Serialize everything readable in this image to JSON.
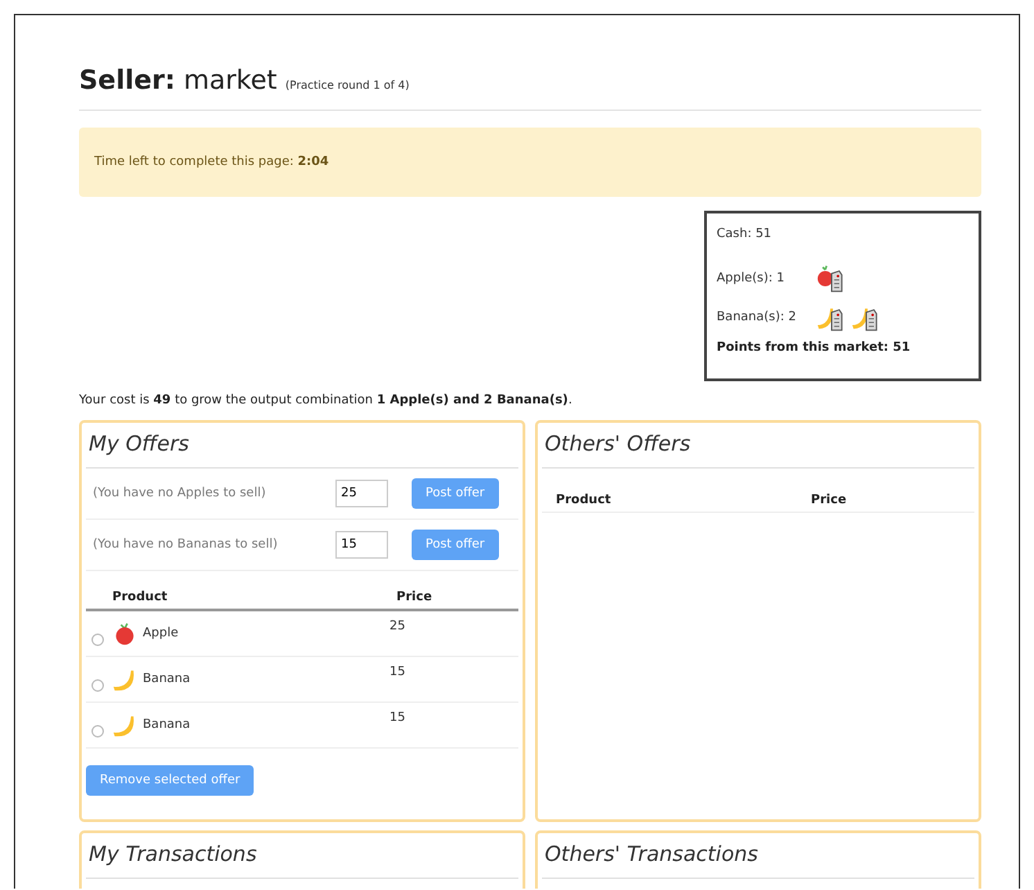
{
  "header": {
    "role": "Seller:",
    "market": "market",
    "round": "(Practice round 1 of 4)"
  },
  "timer": {
    "text": "Time left to complete this page: **2:04**"
  },
  "inventory": {
    "cash": "Cash: 51",
    "items": [
      {
        "label": "Apple(s): 1",
        "tokens": [
          {
            "kind": "apple"
          }
        ]
      },
      {
        "label": "Banana(s): 2",
        "tokens": [
          {
            "kind": "banana"
          },
          {
            "kind": "banana"
          }
        ]
      }
    ],
    "points": "Points from this market: 51"
  },
  "cost_text": "Your cost is **49** to grow the output combination **1 Apple(s) and 2 Banana(s)**.",
  "my_offers": {
    "title": "My Offers",
    "forms": [
      {
        "label": "(You have no Apples to sell)",
        "value": "25",
        "button": "Post offer"
      },
      {
        "label": "(You have no Bananas to sell)",
        "value": "15",
        "button": "Post offer"
      }
    ],
    "columns": [
      "Product",
      "Price"
    ],
    "rows": [
      {
        "kind": "apple",
        "product": "Apple",
        "price": "25",
        "selected": false
      },
      {
        "kind": "banana",
        "product": "Banana",
        "price": "15",
        "selected": false
      },
      {
        "kind": "banana",
        "product": "Banana",
        "price": "15",
        "selected": false
      }
    ],
    "remove_button": "Remove selected offer"
  },
  "others_offers": {
    "title": "Others' Offers",
    "columns": [
      "Product",
      "Price"
    ]
  },
  "my_transactions": {
    "title": "My Transactions"
  },
  "others_transactions": {
    "title": "Others' Transactions"
  }
}
